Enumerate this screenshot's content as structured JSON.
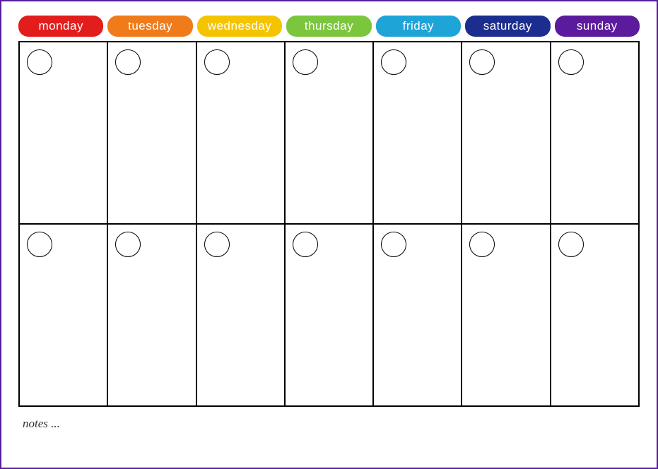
{
  "days": [
    {
      "label": "monday",
      "text_color": "#ffffff",
      "bg_color": "#e31c1c"
    },
    {
      "label": "tuesday",
      "text_color": "#ffffff",
      "bg_color": "#f07b1a"
    },
    {
      "label": "wednesday",
      "text_color": "#ffffff",
      "bg_color": "#f5c400"
    },
    {
      "label": "thursday",
      "text_color": "#ffffff",
      "bg_color": "#7cc63e"
    },
    {
      "label": "friday",
      "text_color": "#ffffff",
      "bg_color": "#1fa4d8"
    },
    {
      "label": "saturday",
      "text_color": "#ffffff",
      "bg_color": "#1b2e8f"
    },
    {
      "label": "sunday",
      "text_color": "#ffffff",
      "bg_color": "#5c1a9c"
    }
  ],
  "rows": 2,
  "notes_label": "notes ..."
}
